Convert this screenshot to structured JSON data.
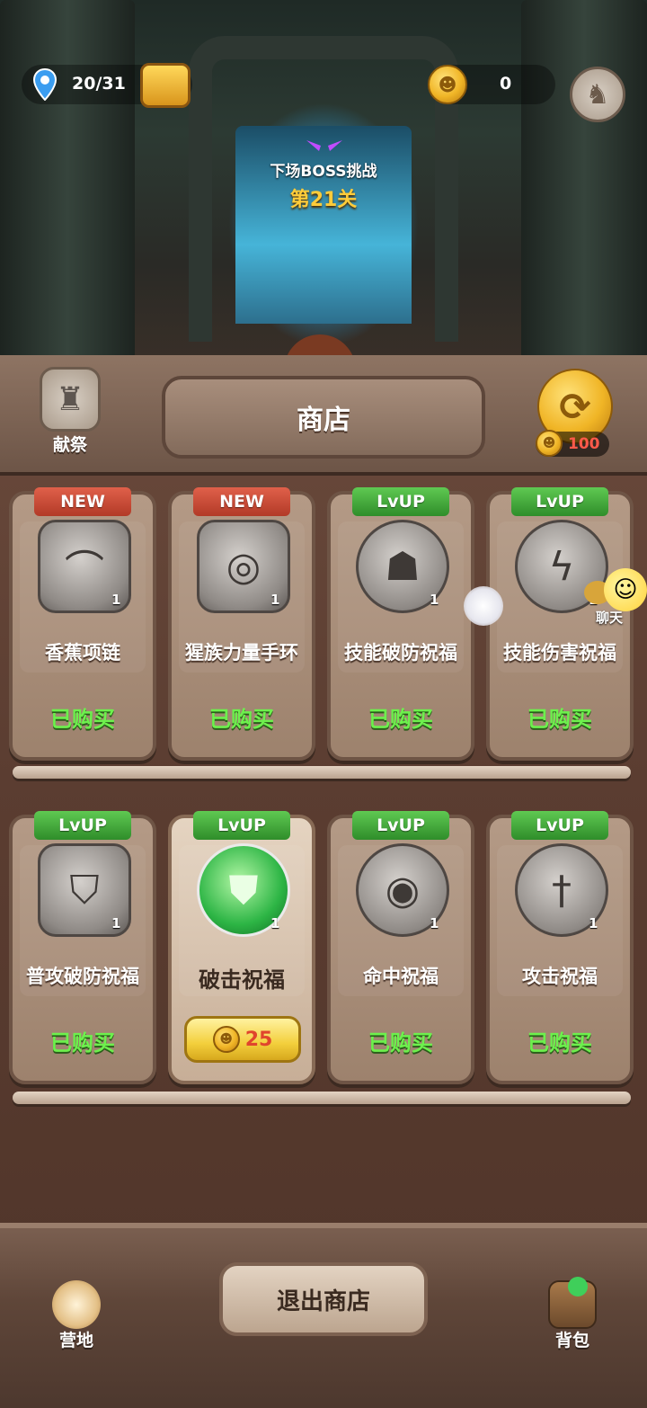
{
  "top_bar": {
    "progress": "20/31",
    "currency_amount": "0",
    "colors": {
      "accent_gold": "#ffcc3a",
      "location_pin": "#3b9df0"
    }
  },
  "boss": {
    "label": "下场BOSS挑战",
    "level": "第21关"
  },
  "shop": {
    "title": "商店",
    "offering_label": "献祭",
    "refresh_cost": "100",
    "chat_label": "聊天",
    "rows": [
      [
        {
          "tag": "NEW",
          "tag_type": "new",
          "name": "香蕉项链",
          "qty": "1",
          "status": "已购买",
          "icon": "banana-necklace-icon"
        },
        {
          "tag": "NEW",
          "tag_type": "new",
          "name": "猩族力量手环",
          "qty": "1",
          "status": "已购买",
          "icon": "bracelet-icon"
        },
        {
          "tag": "LvUP",
          "tag_type": "lvup",
          "name": "技能破防祝福",
          "qty": "1",
          "status": "已购买",
          "icon": "mask-shield-icon"
        },
        {
          "tag": "LvUP",
          "tag_type": "lvup",
          "name": "技能伤害祝福",
          "qty": "1",
          "status": "已购买",
          "icon": "lightning-icon"
        }
      ],
      [
        {
          "tag": "LvUP",
          "tag_type": "lvup",
          "name": "普攻破防祝福",
          "qty": "1",
          "status": "已购买",
          "icon": "broken-shield-icon"
        },
        {
          "tag": "LvUP",
          "tag_type": "lvup",
          "name": "破击祝福",
          "qty": "1",
          "price": "25",
          "icon": "green-shield-icon"
        },
        {
          "tag": "LvUP",
          "tag_type": "lvup",
          "name": "命中祝福",
          "qty": "1",
          "status": "已购买",
          "icon": "eye-icon"
        },
        {
          "tag": "LvUP",
          "tag_type": "lvup",
          "name": "攻击祝福",
          "qty": "1",
          "status": "已购买",
          "icon": "sword-icon"
        }
      ]
    ]
  },
  "bottom": {
    "exit_label": "退出商店",
    "camp_label": "营地",
    "bag_label": "背包"
  }
}
